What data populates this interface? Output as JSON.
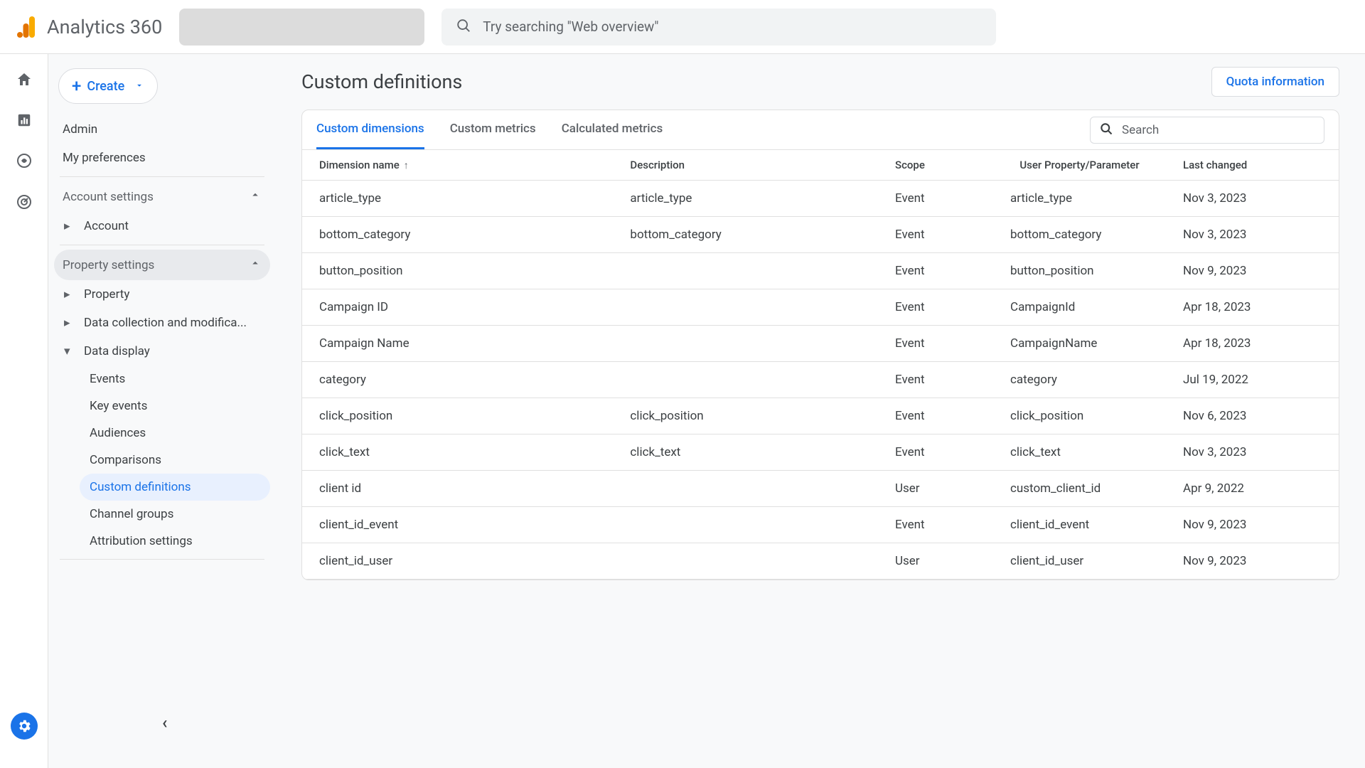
{
  "header": {
    "product_name": "Analytics 360",
    "search_placeholder": "Try searching \"Web overview\""
  },
  "sidebar": {
    "create_label": "Create",
    "admin_label": "Admin",
    "preferences_label": "My preferences",
    "account_settings_label": "Account settings",
    "account_label": "Account",
    "property_settings_label": "Property settings",
    "property_label": "Property",
    "data_collection_label": "Data collection and modifica...",
    "data_display_label": "Data display",
    "items": {
      "events": "Events",
      "key_events": "Key events",
      "audiences": "Audiences",
      "comparisons": "Comparisons",
      "custom_definitions": "Custom definitions",
      "channel_groups": "Channel groups",
      "attribution_settings": "Attribution settings"
    }
  },
  "main": {
    "page_title": "Custom definitions",
    "quota_button": "Quota information",
    "tabs": {
      "dimensions": "Custom dimensions",
      "metrics": "Custom metrics",
      "calculated": "Calculated metrics"
    },
    "table_search_placeholder": "Search",
    "columns": {
      "name": "Dimension name",
      "description": "Description",
      "scope": "Scope",
      "parameter": "User Property/Parameter",
      "last_changed": "Last changed"
    },
    "rows": [
      {
        "name": "article_type",
        "description": "article_type",
        "scope": "Event",
        "parameter": "article_type",
        "last_changed": "Nov 3, 2023"
      },
      {
        "name": "bottom_category",
        "description": "bottom_category",
        "scope": "Event",
        "parameter": "bottom_category",
        "last_changed": "Nov 3, 2023"
      },
      {
        "name": "button_position",
        "description": "",
        "scope": "Event",
        "parameter": "button_position",
        "last_changed": "Nov 9, 2023"
      },
      {
        "name": "Campaign ID",
        "description": "",
        "scope": "Event",
        "parameter": "CampaignId",
        "last_changed": "Apr 18, 2023"
      },
      {
        "name": "Campaign Name",
        "description": "",
        "scope": "Event",
        "parameter": "CampaignName",
        "last_changed": "Apr 18, 2023"
      },
      {
        "name": "category",
        "description": "",
        "scope": "Event",
        "parameter": "category",
        "last_changed": "Jul 19, 2022"
      },
      {
        "name": "click_position",
        "description": "click_position",
        "scope": "Event",
        "parameter": "click_position",
        "last_changed": "Nov 6, 2023"
      },
      {
        "name": "click_text",
        "description": "click_text",
        "scope": "Event",
        "parameter": "click_text",
        "last_changed": "Nov 3, 2023"
      },
      {
        "name": "client id",
        "description": "",
        "scope": "User",
        "parameter": "custom_client_id",
        "last_changed": "Apr 9, 2022"
      },
      {
        "name": "client_id_event",
        "description": "",
        "scope": "Event",
        "parameter": "client_id_event",
        "last_changed": "Nov 9, 2023"
      },
      {
        "name": "client_id_user",
        "description": "",
        "scope": "User",
        "parameter": "client_id_user",
        "last_changed": "Nov 9, 2023"
      }
    ]
  }
}
